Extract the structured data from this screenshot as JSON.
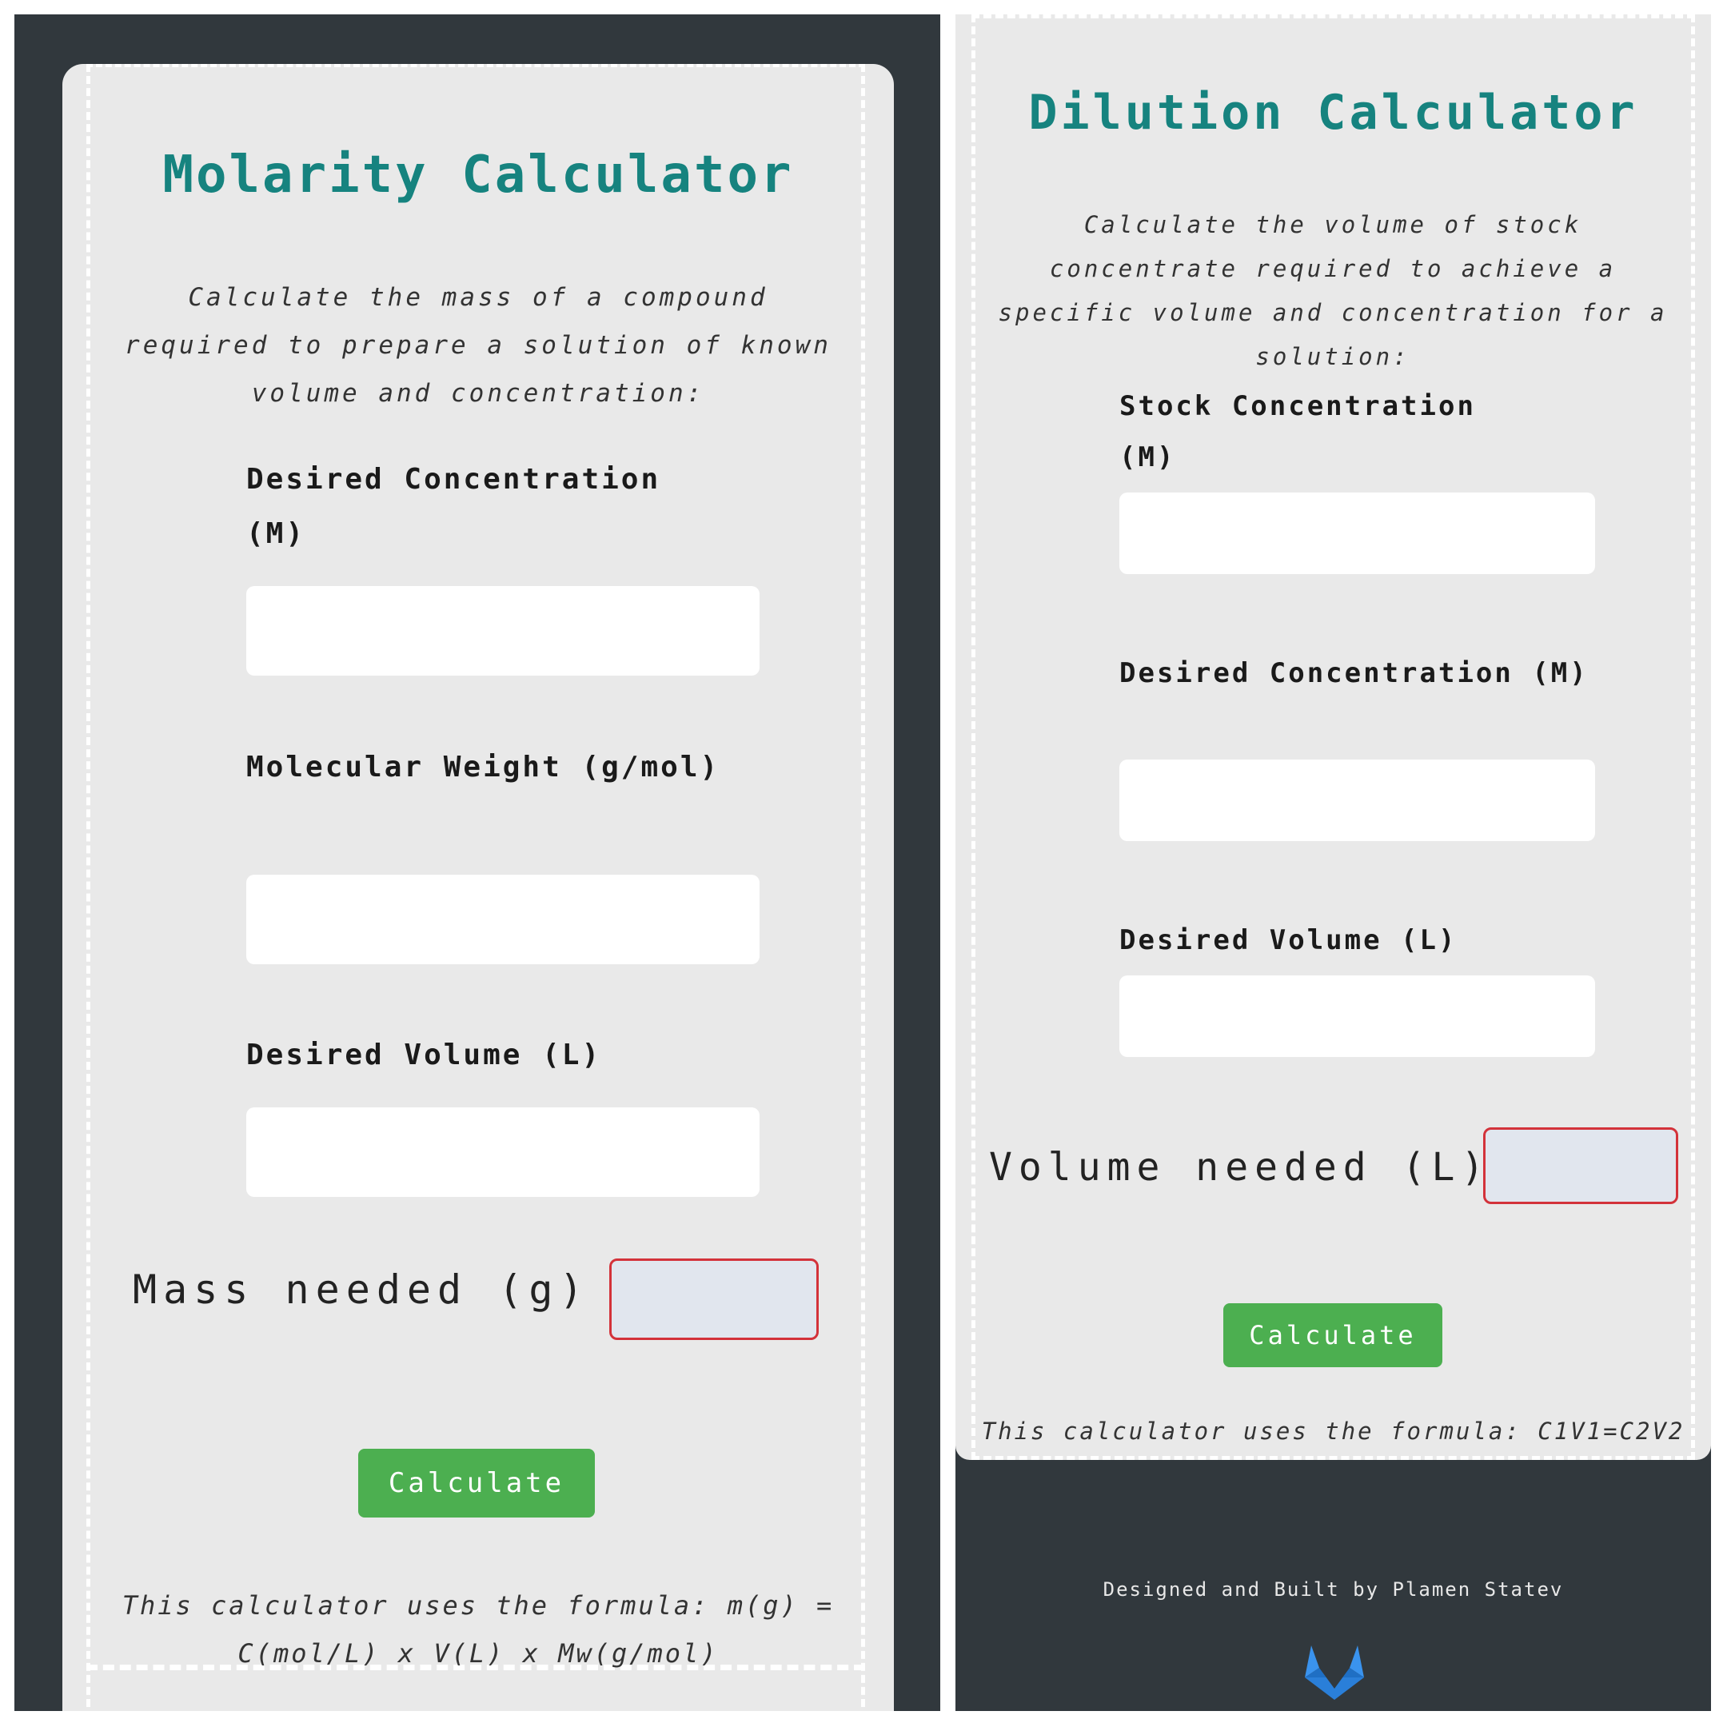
{
  "molarity": {
    "title": "Molarity Calculator",
    "intro": "Calculate the mass of a compound required to prepare a solution of known volume and concentration:",
    "fields": [
      {
        "label": "Desired Concentration (M)",
        "value": ""
      },
      {
        "label": "Molecular Weight (g/mol)",
        "value": ""
      },
      {
        "label": "Desired Volume (L)",
        "value": ""
      }
    ],
    "result_label": "Mass needed (g)",
    "result_value": "",
    "button_label": "Calculate",
    "formula": "This calculator uses the formula: m(g) = C(mol/L) x V(L) x Mw(g/mol)"
  },
  "dilution": {
    "title": "Dilution Calculator",
    "intro": "Calculate the volume of stock concentrate required to achieve a specific volume and concentration for a solution:",
    "fields": [
      {
        "label": "Stock Concentration (M)",
        "value": ""
      },
      {
        "label": "Desired Concentration (M)",
        "value": ""
      },
      {
        "label": "Desired Volume (L)",
        "value": ""
      }
    ],
    "result_label": "Volume needed (L)",
    "result_value": "",
    "button_label": "Calculate",
    "formula": "This calculator uses the formula: C1V1=C2V2"
  },
  "footer": {
    "credit": "Designed and Built by Plamen Statev",
    "icon": "gitlab-icon"
  },
  "colors": {
    "page_background": "#31383d",
    "card_background": "#e9e9e9",
    "title_teal": "#16837f",
    "button_green": "#4caf50",
    "result_border_red": "#d3323a",
    "gitlab_blue": "#2f8ae6"
  }
}
